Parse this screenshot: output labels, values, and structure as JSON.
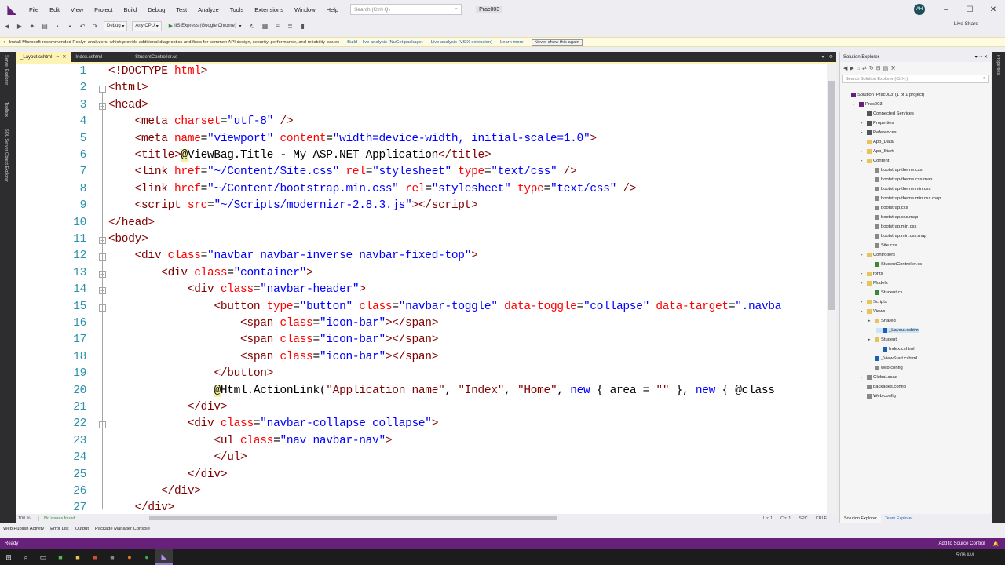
{
  "menubar": {
    "items": [
      "File",
      "Edit",
      "View",
      "Project",
      "Build",
      "Debug",
      "Test",
      "Analyze",
      "Tools",
      "Extensions",
      "Window",
      "Help"
    ],
    "search_placeholder": "Search (Ctrl+Q)",
    "solution": "Prac003",
    "avatar": "AH"
  },
  "toolbar": {
    "config": "Debug",
    "platform": "Any CPU",
    "run_target": "IIS Express (Google Chrome)",
    "liveshare": "Live Share"
  },
  "infobar": {
    "message": "Install Microsoft-recommended Roslyn analyzers, which provide additional diagnostics and fixes for common API design, security, performance, and reliability issues",
    "link1": "Build + live analysis (NuGet package)",
    "link2": "Live analysis (VSIX extension)",
    "link3": "Learn more",
    "button": "Never show this again"
  },
  "rails": {
    "left": [
      "Server Explorer",
      "Toolbox",
      "SQL Server Object Explorer"
    ],
    "right": [
      "Properties"
    ]
  },
  "tabs": [
    {
      "label": "_Layout.cshtml",
      "active": true
    },
    {
      "label": "Index.cshtml",
      "active": false
    },
    {
      "label": "StudentController.cs",
      "active": false
    }
  ],
  "editor": {
    "line_numbers": [
      "1",
      "2",
      "3",
      "4",
      "5",
      "6",
      "7",
      "8",
      "9",
      "10",
      "11",
      "12",
      "13",
      "14",
      "15",
      "16",
      "17",
      "18",
      "19",
      "20",
      "21",
      "22",
      "23",
      "24",
      "25",
      "26",
      "27"
    ],
    "zoom": "100 %",
    "issues": "No issues found",
    "position": [
      "Ln: 1",
      "Ch: 1",
      "SPC",
      "CRLF"
    ]
  },
  "solution_explorer": {
    "title": "Solution Explorer",
    "search_placeholder": "Search Solution Explorer (Ctrl+;)",
    "items": [
      "Solution 'Prac003' (1 of 1 project)",
      "Prac003",
      "Connected Services",
      "Properties",
      "References",
      "App_Data",
      "App_Start",
      "Content",
      "bootstrap-theme.css",
      "bootstrap-theme.css.map",
      "bootstrap-theme.min.css",
      "bootstrap-theme.min.css.map",
      "bootstrap.css",
      "bootstrap.css.map",
      "bootstrap.min.css",
      "bootstrap.min.css.map",
      "Site.css",
      "Controllers",
      "StudentController.cs",
      "fonts",
      "Models",
      "Student.cs",
      "Scripts",
      "Views",
      "Shared",
      "_Layout.cshtml",
      "Student",
      "Index.cshtml",
      "_ViewStart.cshtml",
      "web.config",
      "Global.asax",
      "packages.config",
      "Web.config"
    ],
    "tabs": [
      "Solution Explorer",
      "Team Explorer"
    ]
  },
  "bottom_tabs": [
    "Web Publish Activity",
    "Error List",
    "Output",
    "Package Manager Console"
  ],
  "status": {
    "left": "Ready",
    "right": "Add to Source Control"
  },
  "taskbar": {
    "clock": "5:06 AM"
  },
  "colors": {
    "accent": "#68217a",
    "tag": "#800000",
    "attr": "#ff0000",
    "value": "#0000ff",
    "line_number": "#2b91af"
  }
}
